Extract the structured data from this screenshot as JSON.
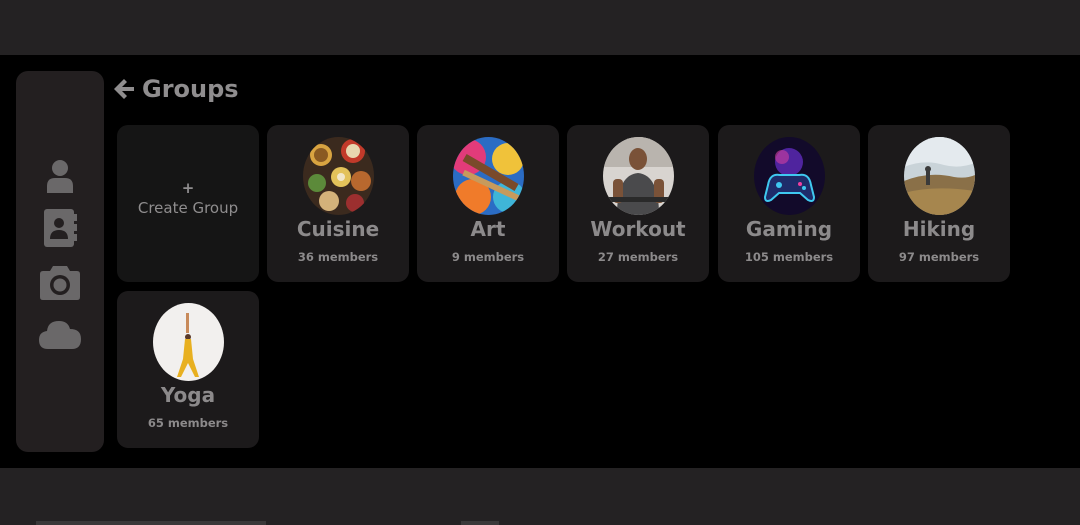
{
  "header": {
    "title": "Groups"
  },
  "create": {
    "plus": "+",
    "label": "Create Group"
  },
  "groups": [
    {
      "name": "Cuisine",
      "members": "36 members"
    },
    {
      "name": "Art",
      "members": "9 members"
    },
    {
      "name": "Workout",
      "members": "27 members"
    },
    {
      "name": "Gaming",
      "members": "105 members"
    },
    {
      "name": "Hiking",
      "members": "97 members"
    },
    {
      "name": "Yoga",
      "members": "65 members"
    }
  ],
  "sidebar": {
    "icons": [
      "user-icon",
      "contact-book-icon",
      "camera-icon",
      "cloud-icon"
    ]
  },
  "colors": {
    "background": "#000000",
    "bars": "#242223",
    "card": "#1c1a1b",
    "text": "#8c8a8b"
  }
}
